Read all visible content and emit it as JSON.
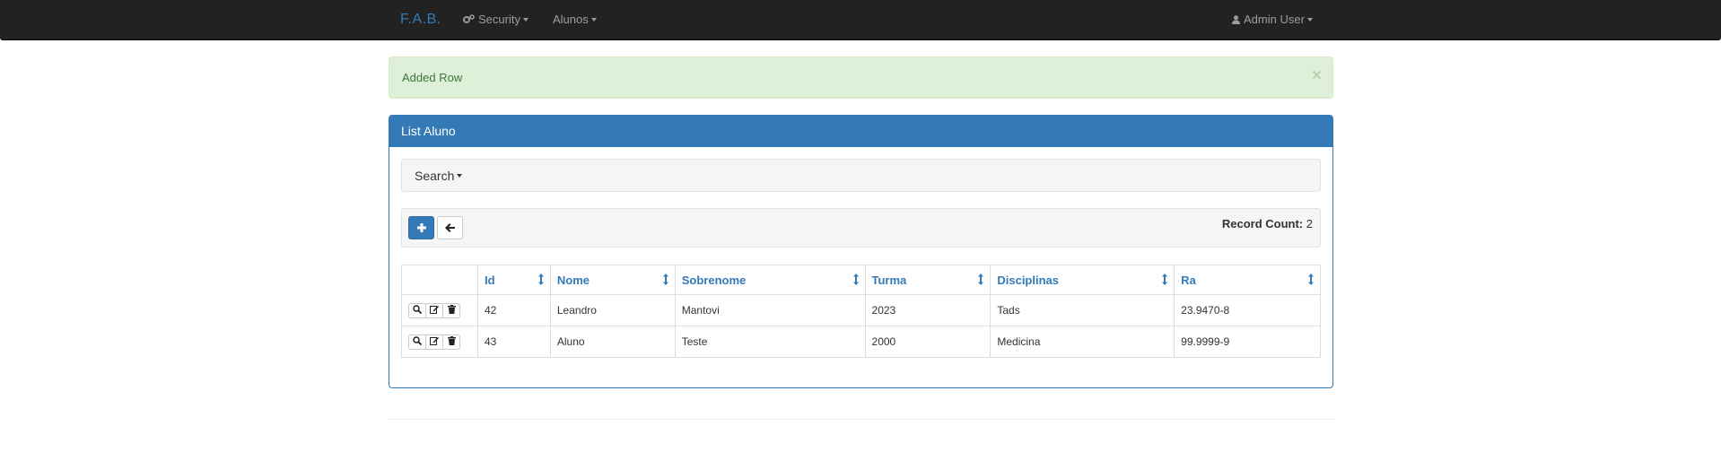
{
  "navbar": {
    "brand": "F.A.B.",
    "security_label": "Security",
    "alunos_label": "Alunos",
    "user_label": "Admin User"
  },
  "alert": {
    "message": "Added Row",
    "close": "×"
  },
  "panel": {
    "title": "List Aluno",
    "search_label": "Search",
    "record_count_label": "Record Count:",
    "record_count_value": "2"
  },
  "table": {
    "headers": [
      "Id",
      "Nome",
      "Sobrenome",
      "Turma",
      "Disciplinas",
      "Ra"
    ],
    "rows": [
      [
        "42",
        "Leandro",
        "Mantovi",
        "2023",
        "Tads",
        "23.9470-8"
      ],
      [
        "43",
        "Aluno",
        "Teste",
        "2000",
        "Medicina",
        "99.9999-9"
      ]
    ]
  },
  "colors": {
    "navbar_bg": "#222222",
    "brand": "#337ab7",
    "panel_primary": "#337ab7",
    "alert_bg": "#dff0d8",
    "alert_text": "#3c763d"
  },
  "icons": {
    "security": "cogs-icon",
    "user": "user-icon",
    "add": "plus-icon",
    "back": "arrow-left-icon",
    "show": "search-icon",
    "edit": "edit-icon",
    "delete": "trash-icon",
    "sort": "sort-icon"
  }
}
